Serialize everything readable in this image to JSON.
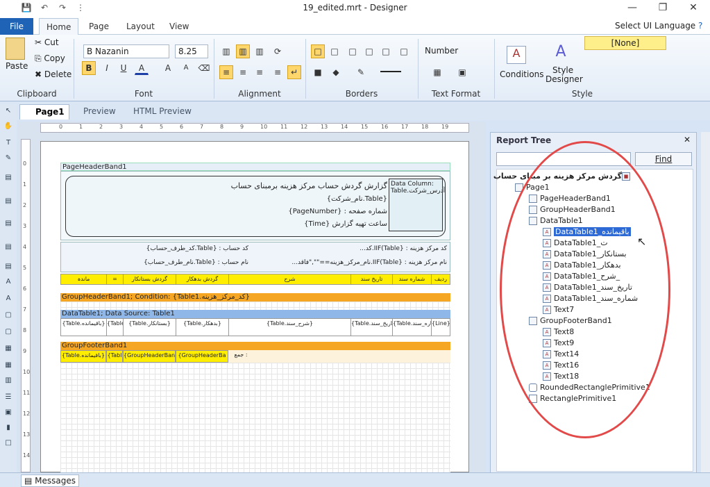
{
  "window": {
    "title": "19_edited.mrt - Designer",
    "minimize": "—",
    "maximize": "❐",
    "close": "✕"
  },
  "quick_access": {
    "save": "💾",
    "undo": "↶",
    "redo": "↷",
    "more": "⋮"
  },
  "tabs": {
    "file": "File",
    "items": [
      "Home",
      "Page",
      "Layout",
      "View"
    ],
    "ui_language": "Select UI Language",
    "help": "?"
  },
  "clipboard": {
    "paste": "Paste",
    "cut": "Cut",
    "copy": "Copy",
    "delete": "Delete",
    "label": "Clipboard"
  },
  "font": {
    "name": "B Nazanin",
    "size": "8.25",
    "bold": "B",
    "italic": "I",
    "underline": "U",
    "color": "A",
    "grow": "A",
    "shrink": "A",
    "label": "Font"
  },
  "alignment": {
    "label": "Alignment"
  },
  "borders": {
    "label": "Borders"
  },
  "text_format": {
    "value": "Number",
    "label": "Text Format"
  },
  "style": {
    "conditions": "Conditions",
    "designer_line1": "Style",
    "designer_line2": "Designer",
    "none": "[None]",
    "label": "Style"
  },
  "doc_tabs": [
    "Page1",
    "Preview",
    "HTML Preview"
  ],
  "ruler_h": [
    "0",
    "1",
    "2",
    "3",
    "4",
    "5",
    "6",
    "7",
    "8",
    "9",
    "10",
    "11",
    "12",
    "13",
    "14",
    "15",
    "16",
    "17",
    "18",
    "19"
  ],
  "ruler_v": [
    "0",
    "1",
    "2",
    "3",
    "4",
    "5",
    "6",
    "7",
    "8",
    "9",
    "10",
    "11",
    "12",
    "13",
    "14"
  ],
  "report": {
    "page_header": "PageHeaderBand1",
    "title_line": "گزارش گردش حساب مرکز هزینه برمبنای حساب",
    "company": "{Table.نام_شرکت}",
    "page_number": "شماره صفحه : {PageNumber}",
    "time": "ساعت تهیه گزارش {Time}",
    "data_column": "Data Column: Table.آدرس_شرکت",
    "cost_code": "کد مرکز هزینه : {IIF(Table.کد...",
    "cost_name": "نام مرکز هزینه : {IIF(Table.نام_مرکز_هزینه==\"\",\"فاقد...",
    "account_code": "کد حساب : {Table.کد_طرف_حساب}",
    "account_name": "نام حساب : {Table.نام_طرف_حساب}",
    "headers": [
      "ماندہ",
      "=",
      "گردش بستانکار",
      "گردش بدهکار",
      "شرح",
      "تاریخ سند",
      "شماره سند",
      "ردیف"
    ],
    "group_header": "GroupHeaderBand1; Condition: {Table1.کد_مرکز_هزینه}",
    "data_band": "DataTable1; Data Source: Table1",
    "data_cells": [
      "{Table.باقیمانده}",
      "{Table",
      "{Table.بستانکار}",
      "{Table.بدهکار}",
      "{Table.شرح_سند}",
      "{Table.تاریخ_سند}",
      "{Table.شماره_سند}",
      "{Line}"
    ],
    "group_footer": "GroupFooterBand1",
    "footer_cells": [
      "{Table.باقیمانده}",
      "{Tabl",
      "{GroupHeaderBand.Table",
      "{GroupHeaderBa",
      "جمع :"
    ]
  },
  "messages": "Messages",
  "report_tree": {
    "title": "Report Tree",
    "close": "✕",
    "search_placeholder": "",
    "find": "Find",
    "root": "گردش مرکز هزینه بر مبنای حساب",
    "page": "Page1",
    "nodes": [
      "PageHeaderBand1",
      "GroupHeaderBand1",
      "DataTable1"
    ],
    "data_children": [
      "DataTable1_باقیمانده",
      "DataTable1_ت",
      "DataTable1_بستانکار",
      "DataTable1_بدهکار",
      "DataTable1_شرح_",
      "DataTable1_تاریخ_سند",
      "DataTable1_شماره_سند",
      "Text7"
    ],
    "footer": "GroupFooterBand1",
    "footer_children": [
      "Text8",
      "Text9",
      "Text14",
      "Text16",
      "Text18"
    ],
    "primitives": [
      "RoundedRectanglePrimitive1",
      "RectanglePrimitive1"
    ]
  },
  "colors": {
    "accent": "#1e63b6",
    "band_yellow": "#ffee00",
    "band_orange": "#f5a623",
    "highlight": "#e24a4a"
  }
}
